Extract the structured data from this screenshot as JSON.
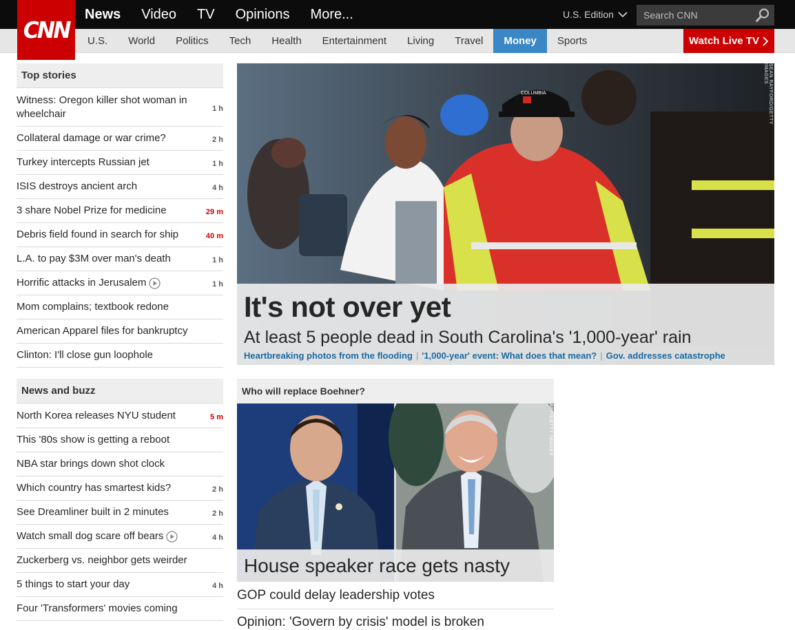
{
  "header": {
    "logo_text": "CNN",
    "primary_nav": [
      {
        "label": "News",
        "active": true
      },
      {
        "label": "Video"
      },
      {
        "label": "TV"
      },
      {
        "label": "Opinions"
      },
      {
        "label": "More..."
      }
    ],
    "edition_label": "U.S. Edition",
    "search_placeholder": "Search CNN",
    "secondary_nav": [
      {
        "label": "U.S."
      },
      {
        "label": "World"
      },
      {
        "label": "Politics"
      },
      {
        "label": "Tech"
      },
      {
        "label": "Health"
      },
      {
        "label": "Entertainment"
      },
      {
        "label": "Living"
      },
      {
        "label": "Travel"
      },
      {
        "label": "Money",
        "active": true
      },
      {
        "label": "Sports"
      }
    ],
    "watch_live_label": "Watch Live TV",
    "colors": {
      "brand": "#cc0000",
      "active_tab": "#3b86c4",
      "top_bar": "#0c0c0c"
    }
  },
  "top_stories": {
    "title": "Top stories",
    "items": [
      {
        "text": "Witness: Oregon killer shot woman in wheelchair",
        "time": "1 h"
      },
      {
        "text": "Collateral damage or war crime?",
        "time": "2 h"
      },
      {
        "text": "Turkey intercepts Russian jet",
        "time": "1 h"
      },
      {
        "text": "ISIS destroys ancient arch",
        "time": "4 h"
      },
      {
        "text": "3 share Nobel Prize for medicine",
        "time": "29 m",
        "fresh": true
      },
      {
        "text": "Debris field found in search for ship",
        "time": "40 m",
        "fresh": true
      },
      {
        "text": "L.A. to pay $3M over man's death",
        "time": "1 h"
      },
      {
        "text": "Horrific attacks in Jerusalem",
        "time": "1 h",
        "video": true
      },
      {
        "text": "Mom complains; textbook redone",
        "time": ""
      },
      {
        "text": "American Apparel files for bankruptcy",
        "time": ""
      },
      {
        "text": "Clinton: I'll close gun loophole",
        "time": ""
      }
    ]
  },
  "news_and_buzz": {
    "title": "News and buzz",
    "items": [
      {
        "text": "North Korea releases NYU student",
        "time": "5 m",
        "fresh": true
      },
      {
        "text": "This '80s show is getting a reboot",
        "time": ""
      },
      {
        "text": "NBA star brings down shot clock",
        "time": ""
      },
      {
        "text": "Which country has smartest kids?",
        "time": "2 h"
      },
      {
        "text": "See Dreamliner built in 2 minutes",
        "time": "2 h"
      },
      {
        "text": "Watch small dog scare off bears",
        "time": "4 h",
        "video": true
      },
      {
        "text": "Zuckerberg vs. neighbor gets weirder",
        "time": ""
      },
      {
        "text": "5 things to start your day",
        "time": "4 h"
      },
      {
        "text": "Four 'Transformers' movies coming",
        "time": ""
      }
    ]
  },
  "hero": {
    "headline": "It's not over yet",
    "subheadline": "At least 5 people dead in South Carolina's '1,000-year' rain",
    "links": [
      "Heartbreaking photos from the flooding",
      "'1,000-year' event: What does that mean?",
      "Gov. addresses catastrophe"
    ],
    "photo_credit": "SEAN RAYFORD/GETTY IMAGES",
    "helmet_text": "COLUMBIA"
  },
  "boehner": {
    "section_title": "Who will replace Boehner?",
    "caption": "House speaker race gets nasty",
    "photo_credit": "AFP/GETTY IMAGES",
    "related": [
      "GOP could delay leadership votes",
      "Opinion: 'Govern by crisis' model is broken"
    ]
  }
}
